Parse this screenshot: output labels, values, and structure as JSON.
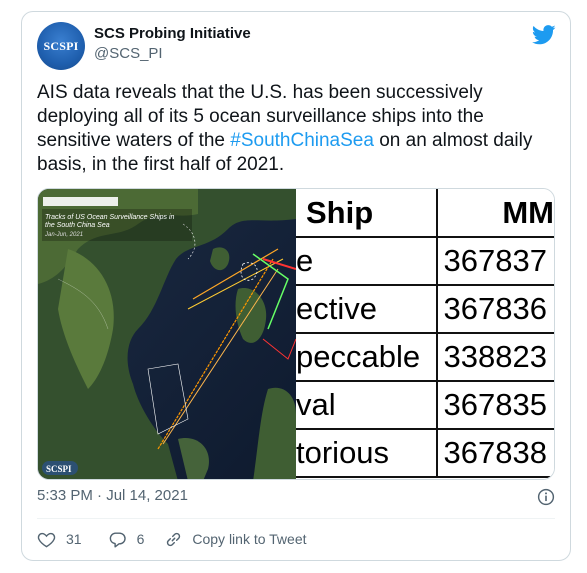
{
  "author": {
    "avatar_text": "SCSPI",
    "name": "SCS Probing Initiative",
    "handle": "@SCS_PI"
  },
  "tweet": {
    "text_before": "AIS data reveals that the U.S. has been successively deploying all of its 5 ocean surveillance ships into the sensitive waters of the ",
    "hashtag": "#SouthChinaSea",
    "text_after": " on an almost daily basis, in the first half of 2021."
  },
  "media": {
    "map": {
      "title": "Tracks of US Ocean Surveillance Ships in the South China Sea",
      "subtitle": "Jan-Jun, 2021",
      "logo": "SCSPI"
    },
    "table": {
      "headers": [
        "Ship",
        "MM"
      ],
      "rows": [
        [
          "e",
          "367837"
        ],
        [
          "ective",
          "367836"
        ],
        [
          "peccable",
          "338823"
        ],
        [
          "val",
          "367835"
        ],
        [
          "torious",
          "367838"
        ]
      ]
    }
  },
  "timestamp": "5:33 PM · Jul 14, 2021",
  "actions": {
    "likes": "31",
    "replies": "6",
    "copy_link": "Copy link to Tweet"
  },
  "colors": {
    "accent": "#1d9bf0",
    "secondary_text": "#536471",
    "heart": "#536471"
  },
  "icons": [
    "twitter-bird-icon",
    "info-icon",
    "heart-icon",
    "reply-icon",
    "link-icon"
  ]
}
